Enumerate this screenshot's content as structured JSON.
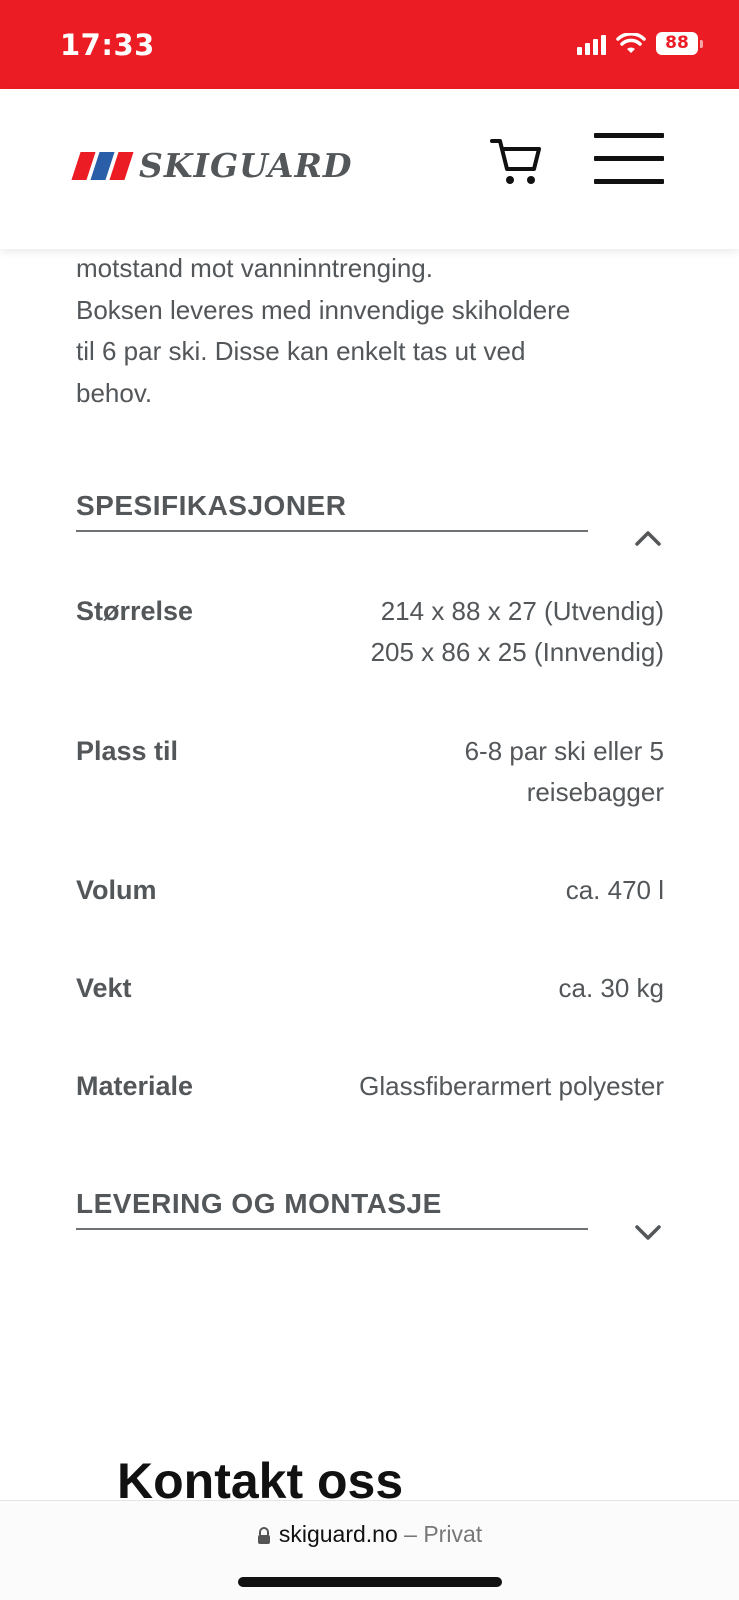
{
  "status_bar": {
    "time": "17:33",
    "battery": "88",
    "background_color": "#ec1c24"
  },
  "header": {
    "logo_text": "SKIGUARD",
    "logo_stripe_colors": [
      "#ec1c24",
      "#2b5ea8",
      "#ec1c24"
    ],
    "cart_icon": "cart-icon",
    "menu_icon": "hamburger-menu-icon"
  },
  "description": {
    "lines": [
      "motstand mot vanninntrenging.",
      "Boksen leveres med innvendige skiholdere",
      "til 6 par ski. Disse kan enkelt tas ut ved",
      "behov."
    ]
  },
  "specifications": {
    "title": "SPESIFIKASJONER",
    "expanded": true,
    "rows": [
      {
        "label": "Størrelse",
        "value_lines": [
          "214 x 88 x 27 (Utvendig)",
          "205 x 86 x 25 (Innvendig)"
        ]
      },
      {
        "label": "Plass til",
        "value_lines": [
          "6-8 par ski eller 5",
          "reisebagger"
        ]
      },
      {
        "label": "Volum",
        "value_lines": [
          "ca. 470 l"
        ]
      },
      {
        "label": "Vekt",
        "value_lines": [
          "ca. 30 kg"
        ]
      },
      {
        "label": "Materiale",
        "value_lines": [
          "Glassfiberarmert polyester"
        ]
      }
    ]
  },
  "delivery": {
    "title": "LEVERING OG MONTASJE",
    "expanded": false
  },
  "contact": {
    "title": "Kontakt oss"
  },
  "browser": {
    "domain": "skiguard.no",
    "separator": " – ",
    "mode": "Privat"
  }
}
